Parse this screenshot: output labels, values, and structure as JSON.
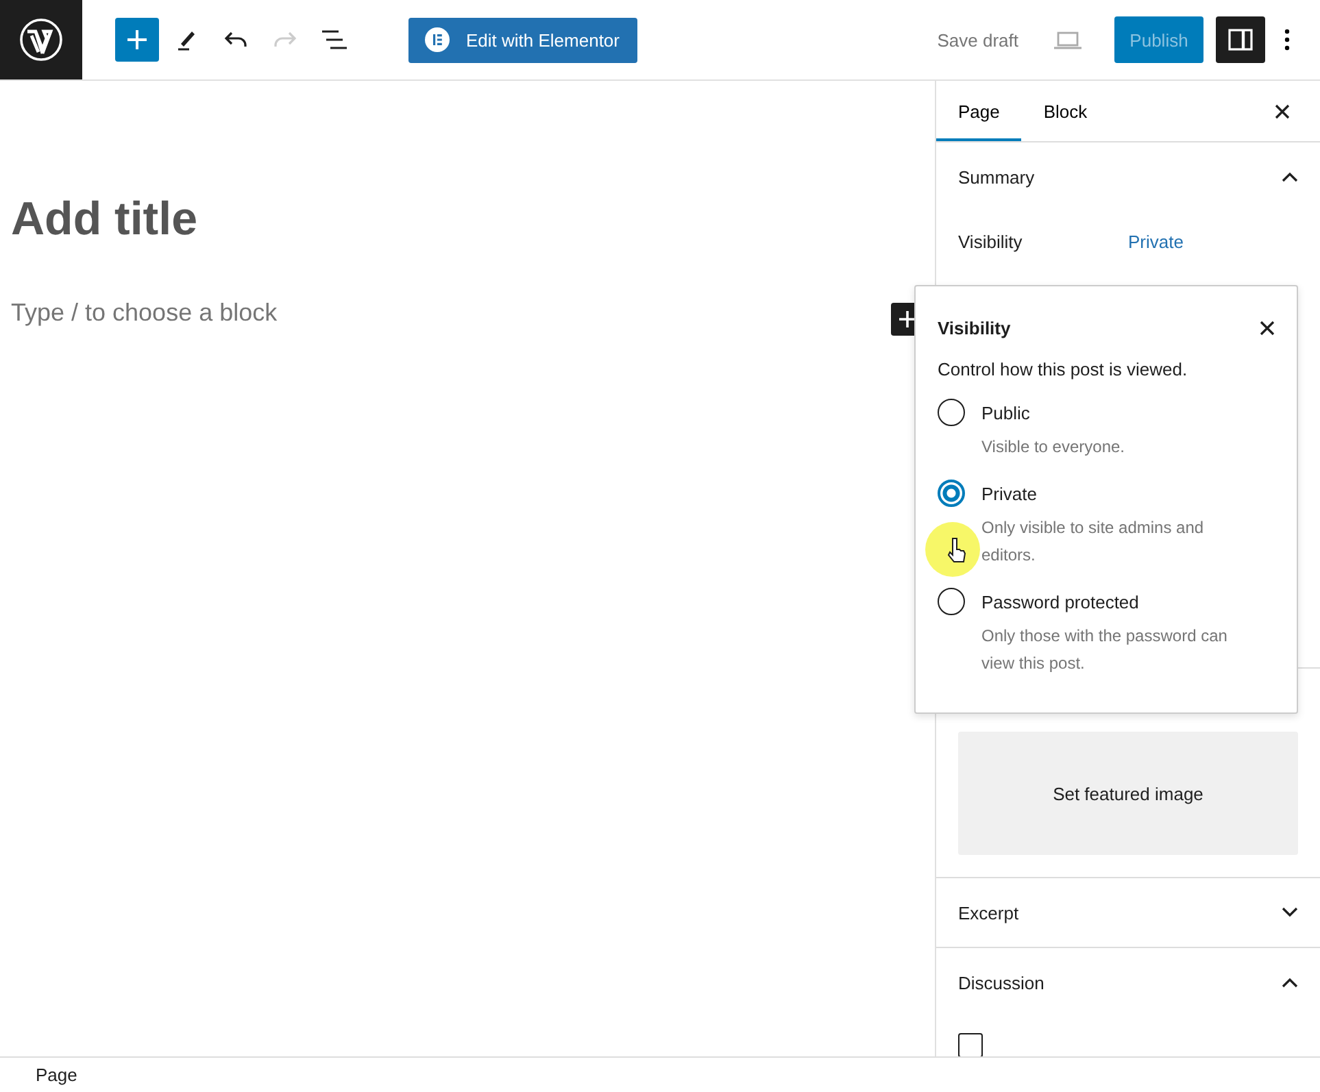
{
  "toolbar": {
    "tools": [
      {
        "kind": "add",
        "disabled": false
      },
      {
        "kind": "edit",
        "disabled": false
      },
      {
        "kind": "undo",
        "disabled": false
      },
      {
        "kind": "redo",
        "disabled": true
      },
      {
        "kind": "list",
        "disabled": false
      }
    ],
    "elementor_button": "Edit with Elementor",
    "save_draft": "Save draft",
    "publish": {
      "label": "Publish",
      "disabled": true
    },
    "settings_pressed": true
  },
  "editor": {
    "title_placeholder": "Add title",
    "block_placeholder": "Type / to choose a block"
  },
  "sidebar": {
    "tabs": [
      {
        "label": "Page",
        "selected": true
      },
      {
        "label": "Block",
        "selected": false
      }
    ],
    "panels": [
      {
        "kind": "summary",
        "title": "Summary",
        "expanded": true,
        "rows": [
          {
            "label": "Visibility",
            "value": "Private"
          }
        ]
      },
      {
        "kind": "featured",
        "button": "Set featured image"
      },
      {
        "kind": "section",
        "title": "Excerpt",
        "expanded": false
      },
      {
        "kind": "discussion",
        "title": "Discussion",
        "expanded": true,
        "checkbox": {
          "checked": false
        }
      }
    ]
  },
  "popover": {
    "title": "Visibility",
    "intro": "Control how this post is viewed.",
    "options": [
      {
        "label": "Public",
        "description": "Visible to everyone.",
        "selected": false
      },
      {
        "label": "Private",
        "description": "Only visible to site admins and editors.",
        "selected": true
      },
      {
        "label": "Password protected",
        "description": "Only those with the password can view this post.",
        "selected": false
      }
    ]
  },
  "status_bar": {
    "breadcrumb": "Page"
  }
}
